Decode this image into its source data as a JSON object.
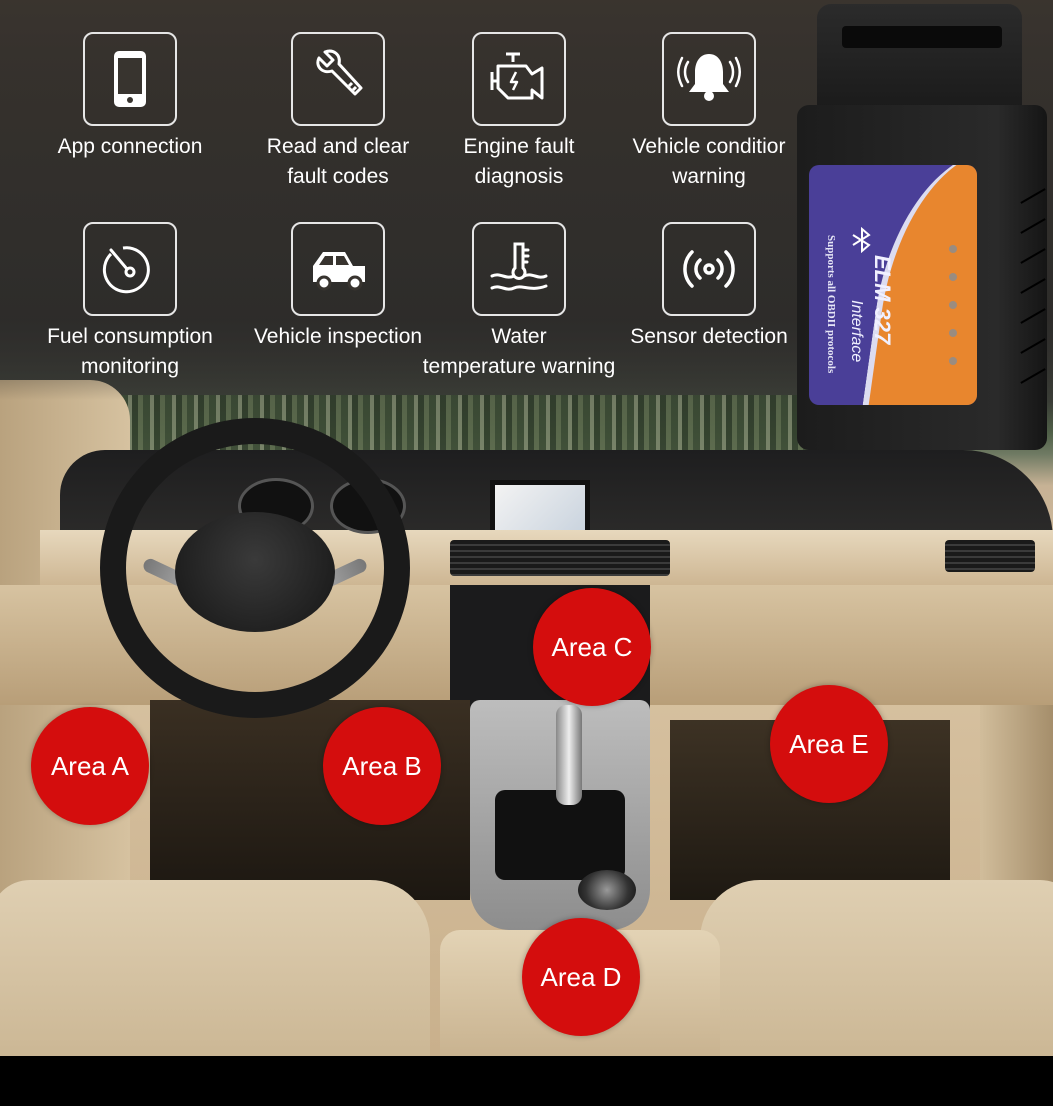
{
  "features": [
    {
      "icon": "smartphone-icon",
      "label": "App connection"
    },
    {
      "icon": "wrench-icon",
      "label": "Read and clear\nfault codes"
    },
    {
      "icon": "engine-icon",
      "label": "Engine fault\ndiagnosis"
    },
    {
      "icon": "bell-alert-icon",
      "label": "Vehicle conditior\nwarning"
    },
    {
      "icon": "gauge-icon",
      "label": "Fuel consumption\nmonitoring"
    },
    {
      "icon": "car-icon",
      "label": "Vehicle inspection"
    },
    {
      "icon": "thermometer-water-icon",
      "label": "Water\ntemperature warning"
    },
    {
      "icon": "signal-icon",
      "label": "Sensor detection"
    }
  ],
  "device": {
    "model": "ELM 327",
    "subtitle": "Interface",
    "support_text": "Supports all OBDII protocols",
    "logo": "bluetooth-icon",
    "label_colors": {
      "blue": "#4a3f98",
      "orange": "#e8862e"
    }
  },
  "areas": [
    {
      "label": "Area A"
    },
    {
      "label": "Area B"
    },
    {
      "label": "Area C"
    },
    {
      "label": "Area D"
    },
    {
      "label": "Area E"
    }
  ],
  "colors": {
    "area_marker": "#d40d0d",
    "icon_stroke": "#e6e6e6"
  }
}
